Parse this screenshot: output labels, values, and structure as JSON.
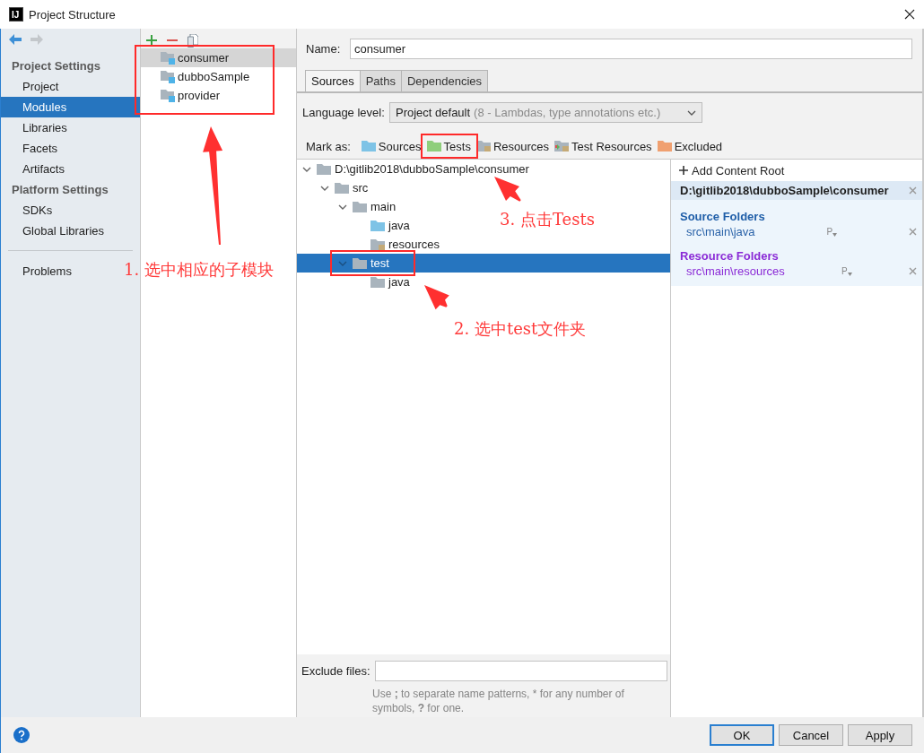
{
  "window": {
    "app_badge": "IJ",
    "title": "Project Structure"
  },
  "sidebar": {
    "groups": [
      {
        "heading": "Project Settings",
        "items": [
          {
            "label": "Project",
            "selected": false
          },
          {
            "label": "Modules",
            "selected": true
          },
          {
            "label": "Libraries",
            "selected": false
          },
          {
            "label": "Facets",
            "selected": false
          },
          {
            "label": "Artifacts",
            "selected": false
          }
        ]
      },
      {
        "heading": "Platform Settings",
        "items": [
          {
            "label": "SDKs",
            "selected": false
          },
          {
            "label": "Global Libraries",
            "selected": false
          }
        ]
      }
    ],
    "footer_items": [
      {
        "label": "Problems",
        "selected": false
      }
    ]
  },
  "modules": [
    {
      "name": "consumer",
      "selected": true
    },
    {
      "name": "dubboSample",
      "selected": false
    },
    {
      "name": "provider",
      "selected": false
    }
  ],
  "module_form": {
    "name_label": "Name:",
    "name_value": "consumer",
    "tabs": [
      {
        "label": "Sources",
        "selected": true
      },
      {
        "label": "Paths",
        "selected": false
      },
      {
        "label": "Dependencies",
        "selected": false
      }
    ],
    "language_label": "Language level:",
    "language_value": "Project default",
    "language_hint": "(8 - Lambdas, type annotations etc.)",
    "mark_label": "Mark as:",
    "mark_options": [
      {
        "label": "Sources",
        "kind": "source"
      },
      {
        "label": "Tests",
        "kind": "test"
      },
      {
        "label": "Resources",
        "kind": "resource"
      },
      {
        "label": "Test Resources",
        "kind": "test_resource"
      },
      {
        "label": "Excluded",
        "kind": "excluded"
      }
    ]
  },
  "tree": [
    {
      "label": "D:\\gitlib2018\\dubboSample\\consumer",
      "kind": "plain",
      "expanded": true,
      "selected": false,
      "children": [
        {
          "label": "src",
          "kind": "plain",
          "expanded": true,
          "selected": false,
          "children": [
            {
              "label": "main",
              "kind": "plain",
              "expanded": true,
              "selected": false,
              "children": [
                {
                  "label": "java",
                  "kind": "source",
                  "selected": false
                },
                {
                  "label": "resources",
                  "kind": "resource",
                  "selected": false
                }
              ]
            },
            {
              "label": "test",
              "kind": "plain",
              "expanded": true,
              "selected": true,
              "children": [
                {
                  "label": "java",
                  "kind": "plain",
                  "selected": false
                }
              ]
            }
          ]
        }
      ]
    }
  ],
  "content_root": {
    "add_label": "Add Content Root",
    "path": "D:\\gitlib2018\\dubboSample\\consumer",
    "sections": [
      {
        "kind": "source",
        "heading": "Source Folders",
        "folders": [
          {
            "path": "src\\main\\java",
            "action": "P"
          }
        ]
      },
      {
        "kind": "resource",
        "heading": "Resource Folders",
        "folders": [
          {
            "path": "src\\main\\resources",
            "action": "P"
          }
        ]
      }
    ]
  },
  "exclude": {
    "label": "Exclude files:",
    "hint": "Use **;** to separate name patterns, * for any number of symbols, **?** for one."
  },
  "buttons": [
    {
      "label": "OK",
      "default": true
    },
    {
      "label": "Cancel",
      "default": false
    },
    {
      "label": "Apply",
      "default": false
    }
  ],
  "annotations": [
    {
      "text": "1. 选中相应的子模块"
    },
    {
      "text": "3. 点击Tests"
    },
    {
      "text": "2. 选中test文件夹"
    }
  ]
}
